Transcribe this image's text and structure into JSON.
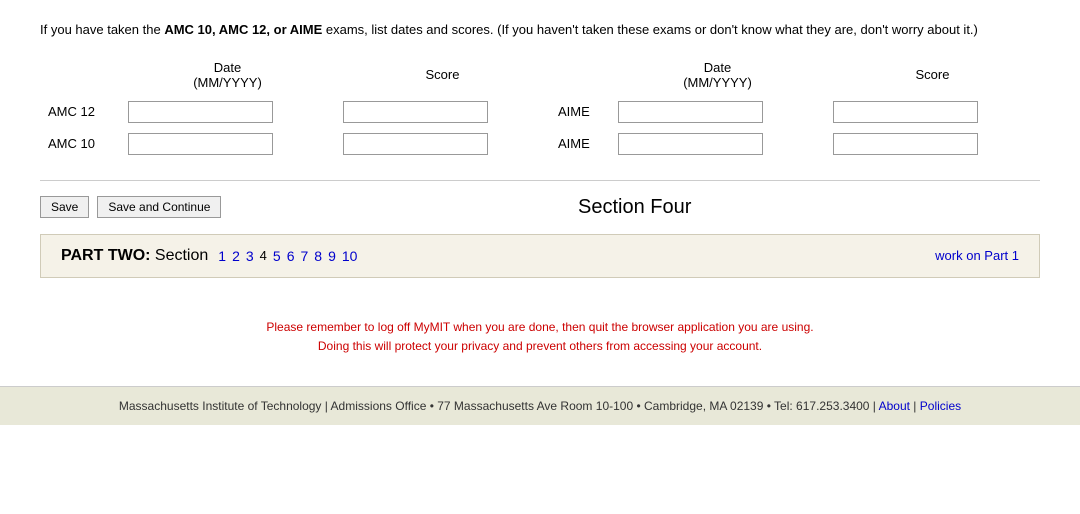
{
  "intro": {
    "text_plain": "If you have taken the ",
    "text_bold1": "AMC 10, AMC 12, or AIME",
    "text_after": " exams, list dates and scores. (If you haven't taken these exams or don't know what they are, don't worry about it.)"
  },
  "columns": {
    "col1_header": "Date\n(MM/YYYY)",
    "col2_header": "Score",
    "col3_header": "Date\n(MM/YYYY)",
    "col4_header": "Score"
  },
  "rows": [
    {
      "label1": "AMC 12",
      "label2": "AIME",
      "date1_placeholder": "",
      "score1_placeholder": "",
      "date2_placeholder": "",
      "score2_placeholder": ""
    },
    {
      "label1": "AMC 10",
      "label2": "AIME",
      "date1_placeholder": "",
      "score1_placeholder": "",
      "date2_placeholder": "",
      "score2_placeholder": ""
    }
  ],
  "buttons": {
    "save": "Save",
    "save_continue": "Save and Continue"
  },
  "section_title": "Section Four",
  "part_two": {
    "label": "PART TWO: Section",
    "links": [
      "1",
      "2",
      "3",
      "4",
      "5",
      "6",
      "7",
      "8",
      "9",
      "10"
    ],
    "work_on_part": "work on Part 1"
  },
  "privacy_notice": {
    "line1": "Please remember to log off MyMIT when you are done, then quit the browser application you are using.",
    "line2": "Doing this will protect your privacy and prevent others from accessing your account."
  },
  "footer": {
    "text": "Massachusetts Institute of Technology | Admissions Office • 77 Massachusetts Ave Room 10-100 • Cambridge, MA 02139 • Tel: 617.253.3400 |",
    "about_label": "About",
    "separator": "|",
    "policies_label": "Policies"
  }
}
